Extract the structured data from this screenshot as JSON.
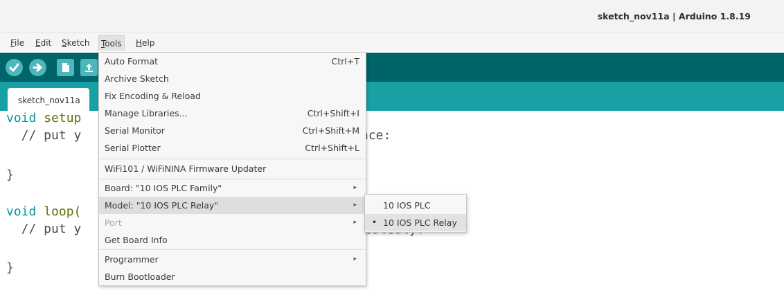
{
  "window": {
    "title": "sketch_nov11a | Arduino 1.8.19"
  },
  "menubar": {
    "items": [
      {
        "label": "File",
        "mnemonic": "F",
        "rest": "ile"
      },
      {
        "label": "Edit",
        "mnemonic": "E",
        "rest": "dit"
      },
      {
        "label": "Sketch",
        "mnemonic": "S",
        "rest": "ketch"
      },
      {
        "label": "Tools",
        "mnemonic": "T",
        "rest": "ools"
      },
      {
        "label": "Help",
        "mnemonic": "H",
        "rest": "elp"
      }
    ]
  },
  "toolbar": {
    "verify_icon": "checkmark-icon",
    "upload_icon": "arrow-right-icon",
    "new_icon": "document-icon",
    "open_icon": "upload-arrow-icon",
    "accent": "#4db7bb",
    "bg": "#006468"
  },
  "tabbar": {
    "tab_label": "sketch_nov11a",
    "bg": "#17a1a5"
  },
  "editor": {
    "line1_kw": "void",
    "line1_fn": "setup",
    "line2": "  // put y",
    "line2b": "nce:",
    "line3": "}",
    "line4_kw": "void",
    "line4_fn": "loop(",
    "line5": "  // put y",
    "line5b": "peatedly:",
    "line6": "}"
  },
  "tools_menu": {
    "auto_format": "Auto Format",
    "auto_format_shortcut": "Ctrl+T",
    "archive_sketch": "Archive Sketch",
    "fix_encoding": "Fix Encoding & Reload",
    "manage_libraries": "Manage Libraries...",
    "manage_libraries_shortcut": "Ctrl+Shift+I",
    "serial_monitor": "Serial Monitor",
    "serial_monitor_shortcut": "Ctrl+Shift+M",
    "serial_plotter": "Serial Plotter",
    "serial_plotter_shortcut": "Ctrl+Shift+L",
    "wifi_updater": "WiFi101 / WiFiNINA Firmware Updater",
    "board": "Board: \"10 IOS PLC Family\"",
    "model": "Model: \"10 IOS PLC Relay\"",
    "port": "Port",
    "get_board_info": "Get Board Info",
    "programmer": "Programmer",
    "burn_bootloader": "Burn Bootloader",
    "arrow": "▸"
  },
  "model_submenu": {
    "items": [
      "10 IOS PLC",
      "10 IOS PLC Relay"
    ],
    "bullet": "•"
  }
}
